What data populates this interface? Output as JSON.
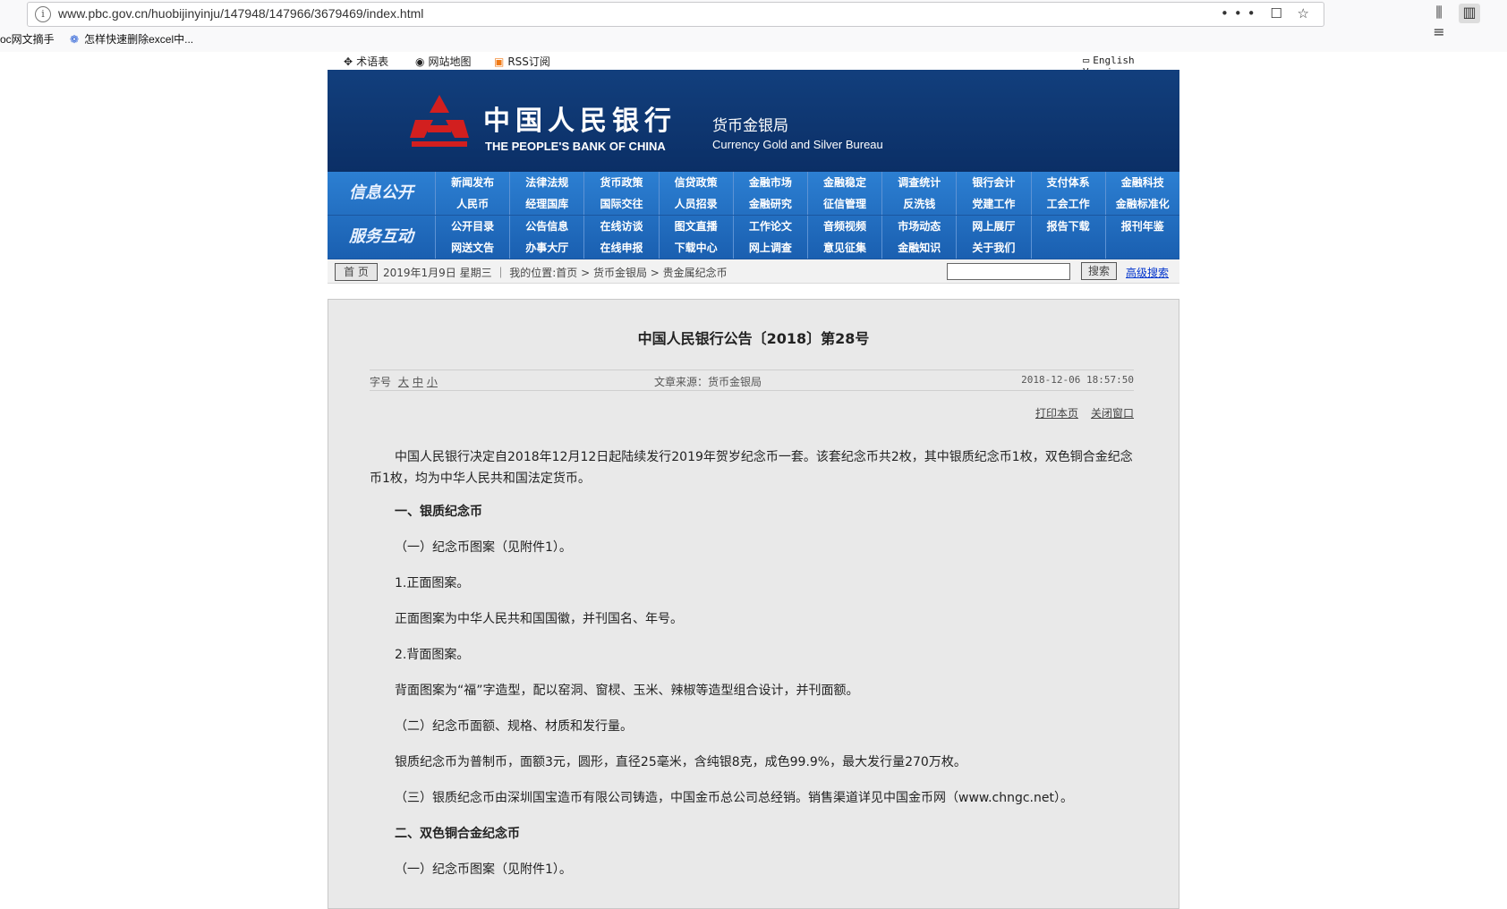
{
  "browser": {
    "url": "www.pbc.gov.cn/huobijinyinju/147948/147966/3679469/index.html",
    "page_actions": "••• ☐ ☆",
    "bookmarks": [
      "oc网文摘手",
      "怎样快速删除excel中..."
    ]
  },
  "toplinks": {
    "glossary": "术语表",
    "sitemap": "网站地图",
    "rss": "RSS订阅",
    "english": "English Version"
  },
  "banner": {
    "title_cn": "中国人民银行",
    "title_en": "THE PEOPLE'S BANK OF CHINA",
    "dept_cn": "货币金银局",
    "dept_en": "Currency  Gold and Silver Bureau"
  },
  "nav": {
    "section1": "信息公开",
    "row1": [
      "新闻发布",
      "法律法规",
      "货币政策",
      "信贷政策",
      "金融市场",
      "金融稳定",
      "调查统计",
      "银行会计",
      "支付体系",
      "金融科技"
    ],
    "row2": [
      "人民币",
      "经理国库",
      "国际交往",
      "人员招录",
      "金融研究",
      "征信管理",
      "反洗钱",
      "党建工作",
      "工会工作",
      "金融标准化"
    ],
    "section2": "服务互动",
    "row3": [
      "公开目录",
      "公告信息",
      "在线访谈",
      "图文直播",
      "工作论文",
      "音频视频",
      "市场动态",
      "网上展厅",
      "报告下载",
      "报刊年鉴"
    ],
    "row4": [
      "网送文告",
      "办事大厅",
      "在线申报",
      "下载中心",
      "网上调查",
      "意见征集",
      "金融知识",
      "关于我们",
      "",
      ""
    ]
  },
  "location": {
    "home": "首 页",
    "date_path": "2019年1月9日 星期三  ｜ 我的位置:首页  >  货币金银局  >  贵金属纪念币",
    "search_button": "搜索",
    "advanced": "高级搜索"
  },
  "article": {
    "title": "中国人民银行公告〔2018〕第28号",
    "fontsize_label": "字号",
    "fontsize_large": "大",
    "fontsize_mid": "中",
    "fontsize_small": "小",
    "source": "文章来源：货币金银局",
    "datetime": "2018-12-06 18:57:50",
    "print": "打印本页",
    "close": "关闭窗口",
    "intro": "中国人民银行决定自2018年12月12日起陆续发行2019年贺岁纪念币一套。该套纪念币共2枚，其中银质纪念币1枚，双色铜合金纪念币1枚，均为中华人民共和国法定货币。",
    "h1": "一、银质纪念币",
    "s1": "（一）纪念币图案（见附件1）。",
    "s1a": "1.正面图案。",
    "s1a_text": "正面图案为中华人民共和国国徽，并刊国名、年号。",
    "s1b": "2.背面图案。",
    "s1b_text": "背面图案为“福”字造型，配以窑洞、窗棂、玉米、辣椒等造型组合设计，并刊面额。",
    "s2": "（二）纪念币面额、规格、材质和发行量。",
    "s2_text": "银质纪念币为普制币，面额3元，圆形，直径25毫米，含纯银8克，成色99.9%，最大发行量270万枚。",
    "s3": "（三）银质纪念币由深圳国宝造币有限公司铸造，中国金币总公司总经销。销售渠道详见中国金币网（www.chngc.net）。",
    "h2": "二、双色铜合金纪念币",
    "s4": "（一）纪念币图案（见附件1）。"
  }
}
